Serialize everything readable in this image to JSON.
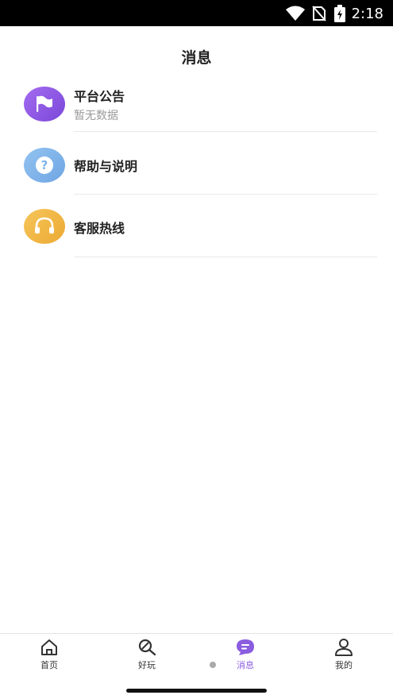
{
  "status_bar": {
    "time": "2:18"
  },
  "header": {
    "title": "消息"
  },
  "messages": [
    {
      "title": "平台公告",
      "subtitle": "暂无数据",
      "icon": "flag-icon",
      "color": "#8b5be6"
    },
    {
      "title": "帮助与说明",
      "icon": "question-icon",
      "color": "#7fb3ea"
    },
    {
      "title": "客服热线",
      "icon": "headset-icon",
      "color": "#f2b844"
    }
  ],
  "nav": {
    "items": [
      {
        "label": "首页",
        "icon": "home-icon"
      },
      {
        "label": "好玩",
        "icon": "search-icon"
      },
      {
        "label": "消息",
        "icon": "message-icon",
        "active": true
      },
      {
        "label": "我的",
        "icon": "user-icon"
      }
    ],
    "accent": "#8a5ce0"
  }
}
